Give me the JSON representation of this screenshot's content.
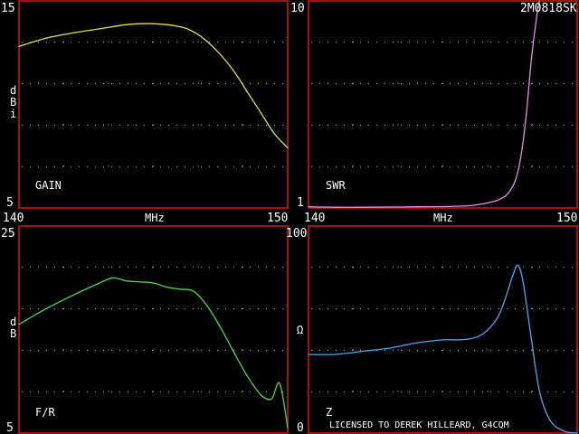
{
  "design_id": "2M0818SK",
  "license": "LICENSED TO DEREK HILLEARD, G4CQM",
  "colors": {
    "background": "#000000",
    "frame": "#d01a1a",
    "grid": "#c8c8c8",
    "text": "#ffffff",
    "license_text": "#8c8c8c"
  },
  "chart_data": [
    {
      "id": "gain",
      "type": "line",
      "panel_label": "GAIN",
      "ylabel": "dBi",
      "xlabel": "MHz",
      "x_ticks": [
        "140",
        "150"
      ],
      "y_ticks": [
        "5",
        "15"
      ],
      "xlim": [
        140,
        150
      ],
      "ylim": [
        5,
        15
      ],
      "grid": true,
      "color": "#e3e33c",
      "series": [
        {
          "x": [
            140,
            141,
            142,
            143,
            144,
            145,
            146,
            146.5,
            147,
            147.5,
            148,
            148.5,
            149,
            149.5,
            150
          ],
          "y": [
            12.8,
            13.2,
            13.45,
            13.65,
            13.85,
            13.9,
            13.75,
            13.5,
            13.05,
            12.4,
            11.6,
            10.6,
            9.6,
            8.6,
            7.9
          ]
        }
      ]
    },
    {
      "id": "swr",
      "type": "line",
      "panel_label": "SWR",
      "xlabel": "MHz",
      "x_ticks": [
        "140",
        "150"
      ],
      "y_ticks": [
        "1",
        "10"
      ],
      "xlim": [
        140,
        150
      ],
      "ylim": [
        1,
        10
      ],
      "grid": true,
      "color": "#e48ee8",
      "series": [
        {
          "x": [
            140,
            141,
            142,
            143,
            144,
            145,
            146,
            146.5,
            147,
            147.3,
            147.5,
            147.7,
            147.9,
            148.1,
            148.3,
            148.5,
            148.6
          ],
          "y": [
            1.05,
            1.03,
            1.03,
            1.04,
            1.05,
            1.06,
            1.1,
            1.18,
            1.32,
            1.5,
            1.75,
            2.2,
            3.2,
            5.0,
            7.5,
            9.4,
            10
          ]
        }
      ]
    },
    {
      "id": "fr",
      "type": "line",
      "panel_label": "F/R",
      "ylabel": "dB",
      "x_ticks": [],
      "y_ticks": [
        "5",
        "25"
      ],
      "xlim": [
        140,
        150
      ],
      "ylim": [
        5,
        25
      ],
      "grid": true,
      "color": "#4ed84e",
      "series": [
        {
          "x": [
            140,
            141,
            142,
            143,
            143.5,
            144,
            144.5,
            145,
            145.5,
            146,
            146.5,
            147,
            147.5,
            148,
            148.5,
            149,
            149.4,
            149.7,
            150
          ],
          "y": [
            15.5,
            17.0,
            18.3,
            19.5,
            20.0,
            19.7,
            19.6,
            19.5,
            19.1,
            18.9,
            18.7,
            17.3,
            15.2,
            12.8,
            10.5,
            8.7,
            8.3,
            9.8,
            5.5
          ]
        }
      ]
    },
    {
      "id": "z",
      "type": "line",
      "panel_label": "Z",
      "ylabel": "Ω",
      "x_ticks": [],
      "y_ticks": [
        "0",
        "100"
      ],
      "xlim": [
        140,
        150
      ],
      "ylim": [
        0,
        100
      ],
      "grid": true,
      "color": "#4aa8f0",
      "series": [
        {
          "x": [
            140,
            141,
            142,
            143,
            144,
            145,
            145.5,
            146,
            146.5,
            147,
            147.3,
            147.6,
            147.8,
            148,
            148.3,
            148.6,
            149,
            149.5,
            150
          ],
          "y": [
            38,
            38,
            39.5,
            41,
            43.5,
            45,
            45,
            45.5,
            48,
            55,
            64,
            76,
            81,
            72,
            45,
            20,
            6,
            1,
            0
          ]
        }
      ]
    }
  ]
}
